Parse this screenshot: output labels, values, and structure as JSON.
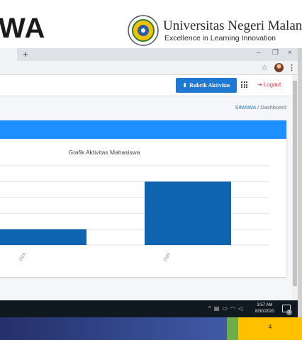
{
  "slide": {
    "title_fragment": "WA",
    "university_name": "Universitas Negeri Malang",
    "university_tagline": "Excellence in Learning Innovation",
    "page_number": "4"
  },
  "browser": {
    "new_tab_symbol": "+",
    "minimize_symbol": "–",
    "restore_symbol": "❐",
    "close_symbol": "×",
    "bookmark_icon": "star-icon",
    "menu_icon": "kebab-icon"
  },
  "navbar": {
    "rubrik_label": "Rubrik Aktivitas",
    "logout_label": "Logout"
  },
  "breadcrumb": {
    "root": "SIMAWA",
    "separator": "/",
    "current": "Dashboard"
  },
  "colors": {
    "accent": "#1f78d1",
    "card_header": "#1e90ff",
    "bar": "#0f64b0",
    "logout": "#dc3545",
    "footer_green": "#70ad47",
    "footer_yellow": "#ffc000"
  },
  "taskbar": {
    "time": "3:57 AM",
    "date": "8/30/2020",
    "notification_count": "2"
  },
  "chart_data": {
    "type": "bar",
    "title": "Grafik Aktivitas Mahasiswa",
    "categories": [
      "2019",
      "2020"
    ],
    "values": [
      0.25,
      1.0
    ],
    "ylim": [
      0,
      1.25
    ],
    "grid": true,
    "xlabel": "",
    "ylabel": ""
  }
}
